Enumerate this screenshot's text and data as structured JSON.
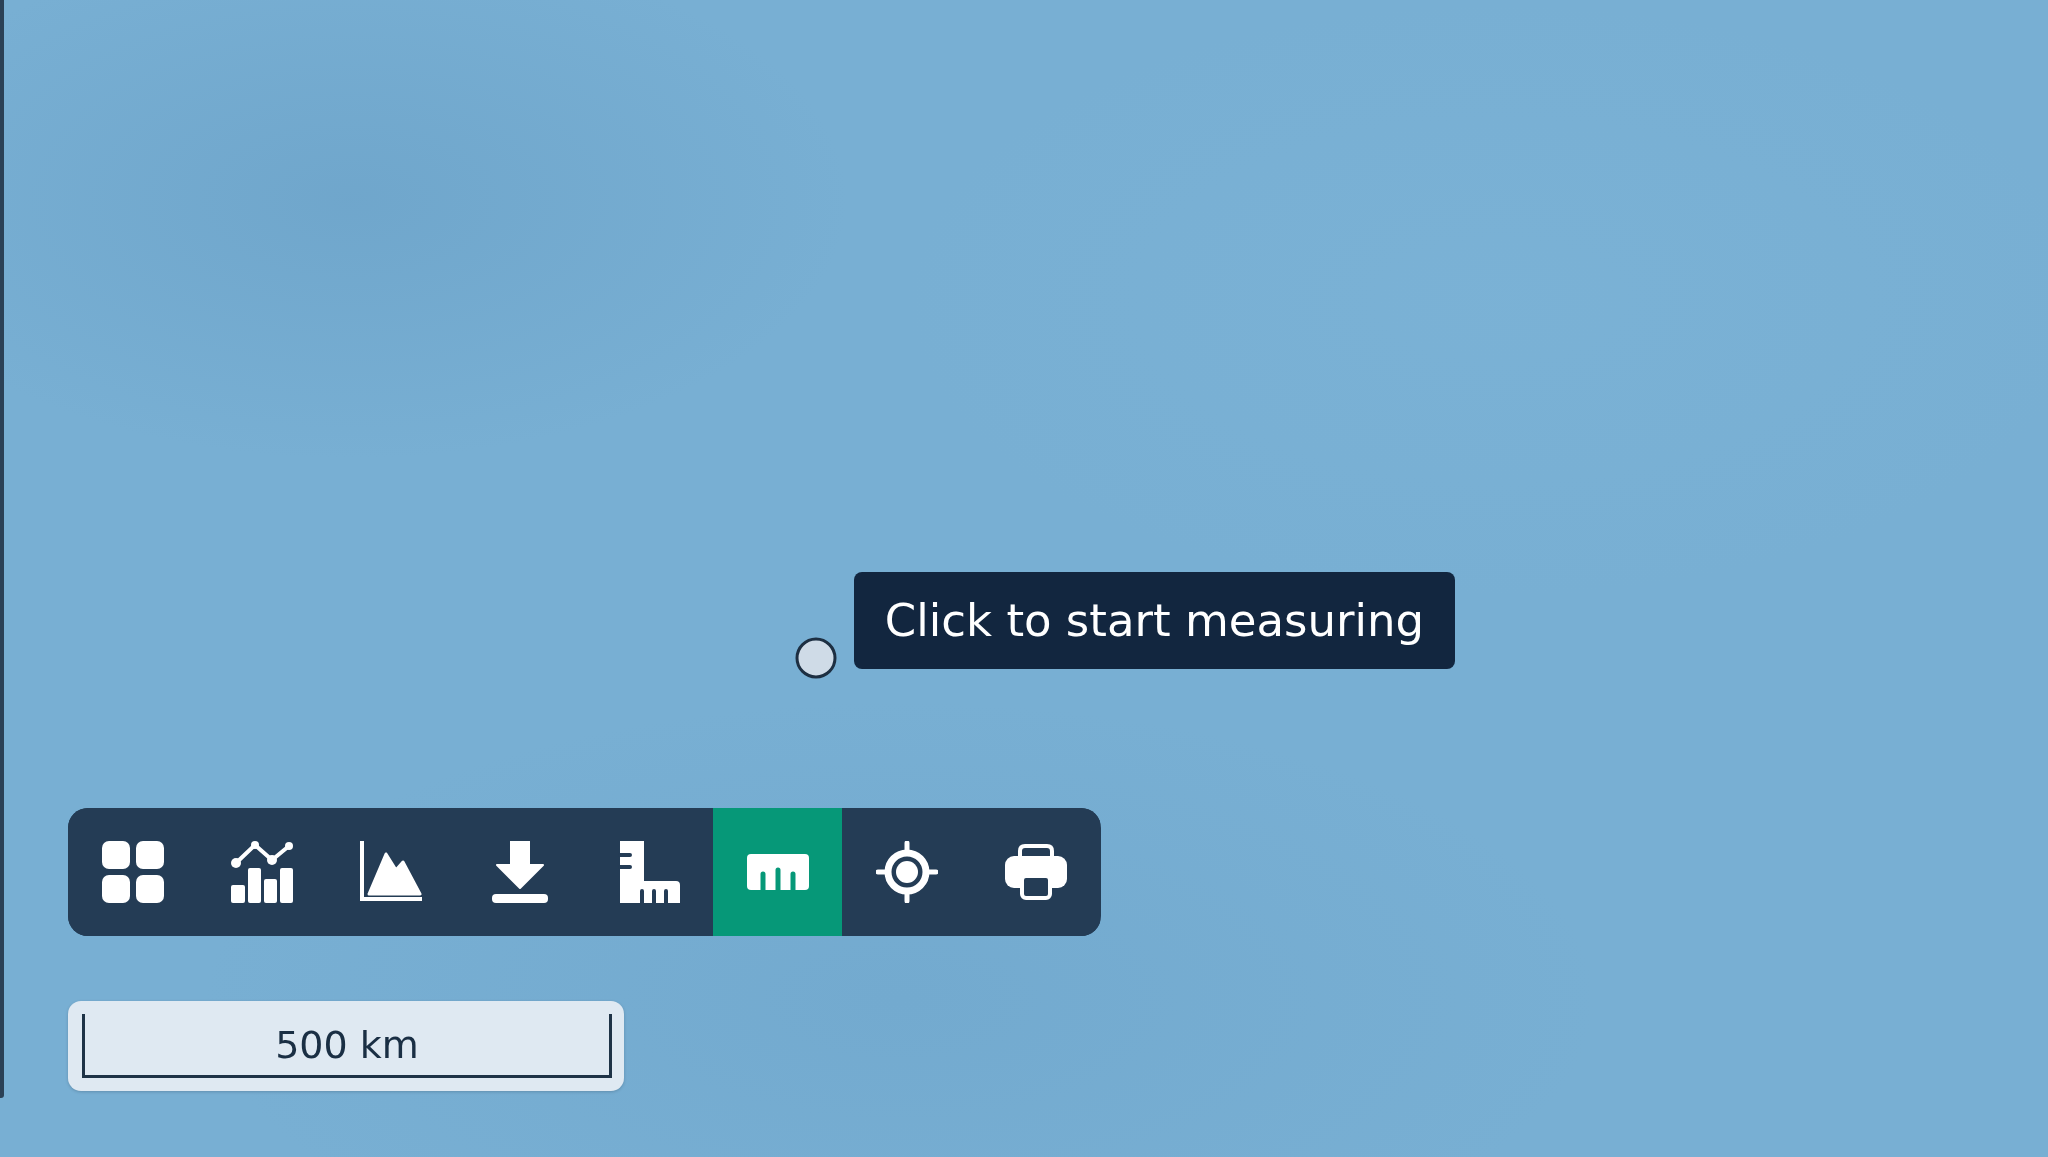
{
  "tooltip": {
    "text": "Click to start measuring"
  },
  "toolbar": {
    "buttons": [
      {
        "selected": false
      },
      {
        "selected": false
      },
      {
        "selected": false
      },
      {
        "selected": false
      },
      {
        "selected": false
      },
      {
        "selected": true
      },
      {
        "selected": false
      },
      {
        "selected": false
      }
    ]
  },
  "scale_bar": {
    "label": "500 km"
  }
}
